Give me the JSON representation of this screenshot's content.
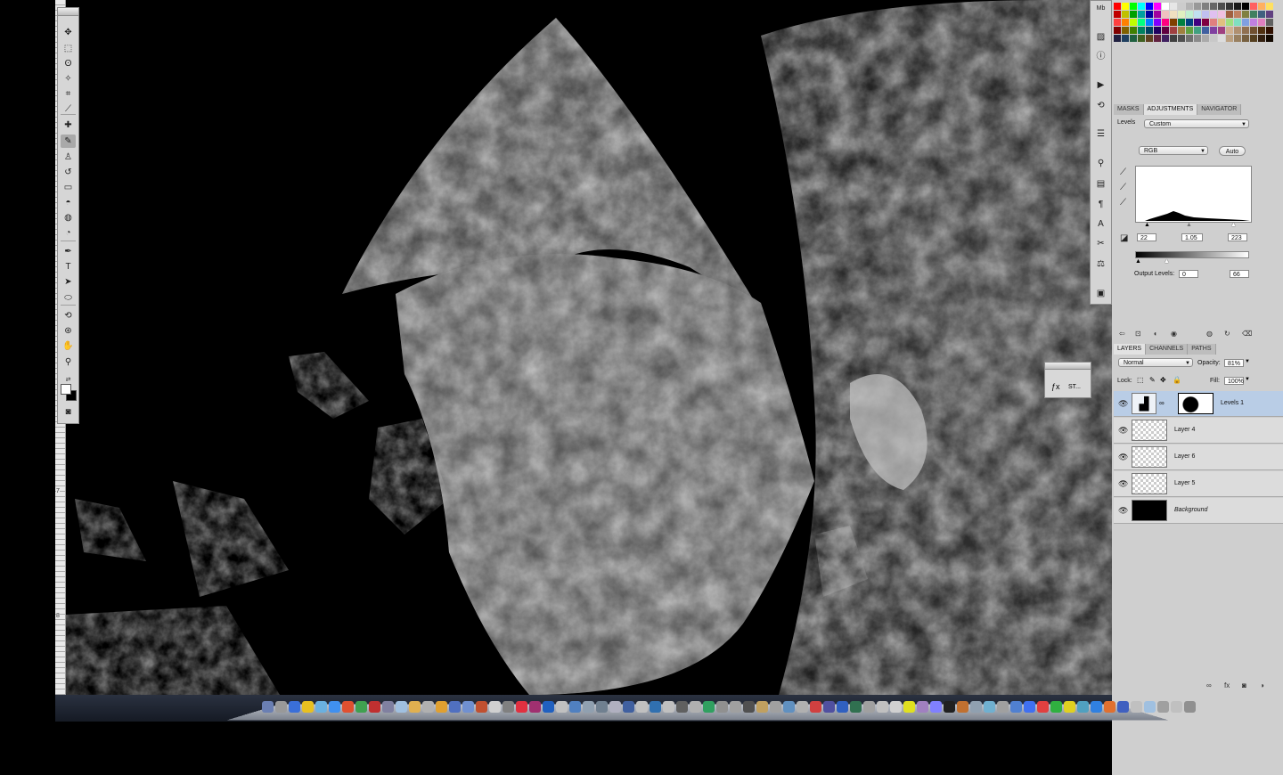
{
  "ruler": {
    "marks": [
      "7",
      "8"
    ]
  },
  "tools": [
    {
      "name": "move-tool",
      "glyph": "✥"
    },
    {
      "name": "marquee-tool",
      "glyph": "⬚"
    },
    {
      "name": "lasso-tool",
      "glyph": "ʘ"
    },
    {
      "name": "magic-wand-tool",
      "glyph": "✧"
    },
    {
      "name": "crop-tool",
      "glyph": "⌗"
    },
    {
      "name": "eyedropper-tool",
      "glyph": "⟋"
    },
    {
      "name": "healing-brush-tool",
      "glyph": "✚"
    },
    {
      "name": "brush-tool",
      "glyph": "✎"
    },
    {
      "name": "clone-stamp-tool",
      "glyph": "♙"
    },
    {
      "name": "history-brush-tool",
      "glyph": "↺"
    },
    {
      "name": "eraser-tool",
      "glyph": "▭"
    },
    {
      "name": "paint-bucket-tool",
      "glyph": "◓"
    },
    {
      "name": "blur-tool",
      "glyph": "◍"
    },
    {
      "name": "dodge-tool",
      "glyph": "◔"
    },
    {
      "name": "pen-tool",
      "glyph": "✒"
    },
    {
      "name": "type-tool",
      "glyph": "T"
    },
    {
      "name": "path-selection-tool",
      "glyph": "➤"
    },
    {
      "name": "ellipse-tool",
      "glyph": "⬭"
    },
    {
      "name": "3d-rotate-tool",
      "glyph": "⟲"
    },
    {
      "name": "3d-orbit-tool",
      "glyph": "⊛"
    },
    {
      "name": "hand-tool",
      "glyph": "✋"
    },
    {
      "name": "zoom-tool",
      "glyph": "⚲"
    }
  ],
  "adjustments": {
    "tabs": [
      "MASKS",
      "ADJUSTMENTS",
      "NAVIGATOR"
    ],
    "active_tab": "ADJUSTMENTS",
    "type_label": "Levels",
    "preset": "Custom",
    "channel": "RGB",
    "auto_label": "Auto",
    "input_black": "22",
    "input_gamma": "1.05",
    "input_white": "223",
    "output_label": "Output Levels:",
    "output_black": "0",
    "output_white": "66"
  },
  "layers_panel": {
    "tabs": [
      "LAYERS",
      "CHANNELS",
      "PATHS"
    ],
    "active_tab": "LAYERS",
    "blend_mode": "Normal",
    "opacity_label": "Opacity:",
    "opacity": "81%",
    "lock_label": "Lock:",
    "fill_label": "Fill:",
    "fill": "100%",
    "layers": [
      {
        "name": "Levels 1",
        "active": true,
        "kind": "adjustment"
      },
      {
        "name": "Layer 4",
        "active": false,
        "kind": "pixel"
      },
      {
        "name": "Layer 6",
        "active": false,
        "kind": "pixel"
      },
      {
        "name": "Layer 5",
        "active": false,
        "kind": "pixel"
      },
      {
        "name": "Background",
        "active": false,
        "kind": "background"
      }
    ]
  },
  "styles_panel": {
    "label": "ST..."
  },
  "side_icons": [
    "mini-bridge-icon",
    "histogram-icon",
    "info-icon",
    "actions-icon",
    "history-icon",
    "brush-presets-icon",
    "clone-source-icon",
    "tool-presets-icon",
    "paragraph-icon",
    "character-icon",
    "3d-icon",
    "measurement-icon",
    "notes-icon"
  ],
  "colors": {
    "panel_bg": "#cfcfcf",
    "active_layer": "#b9cde6",
    "dock": "#1b2130"
  }
}
